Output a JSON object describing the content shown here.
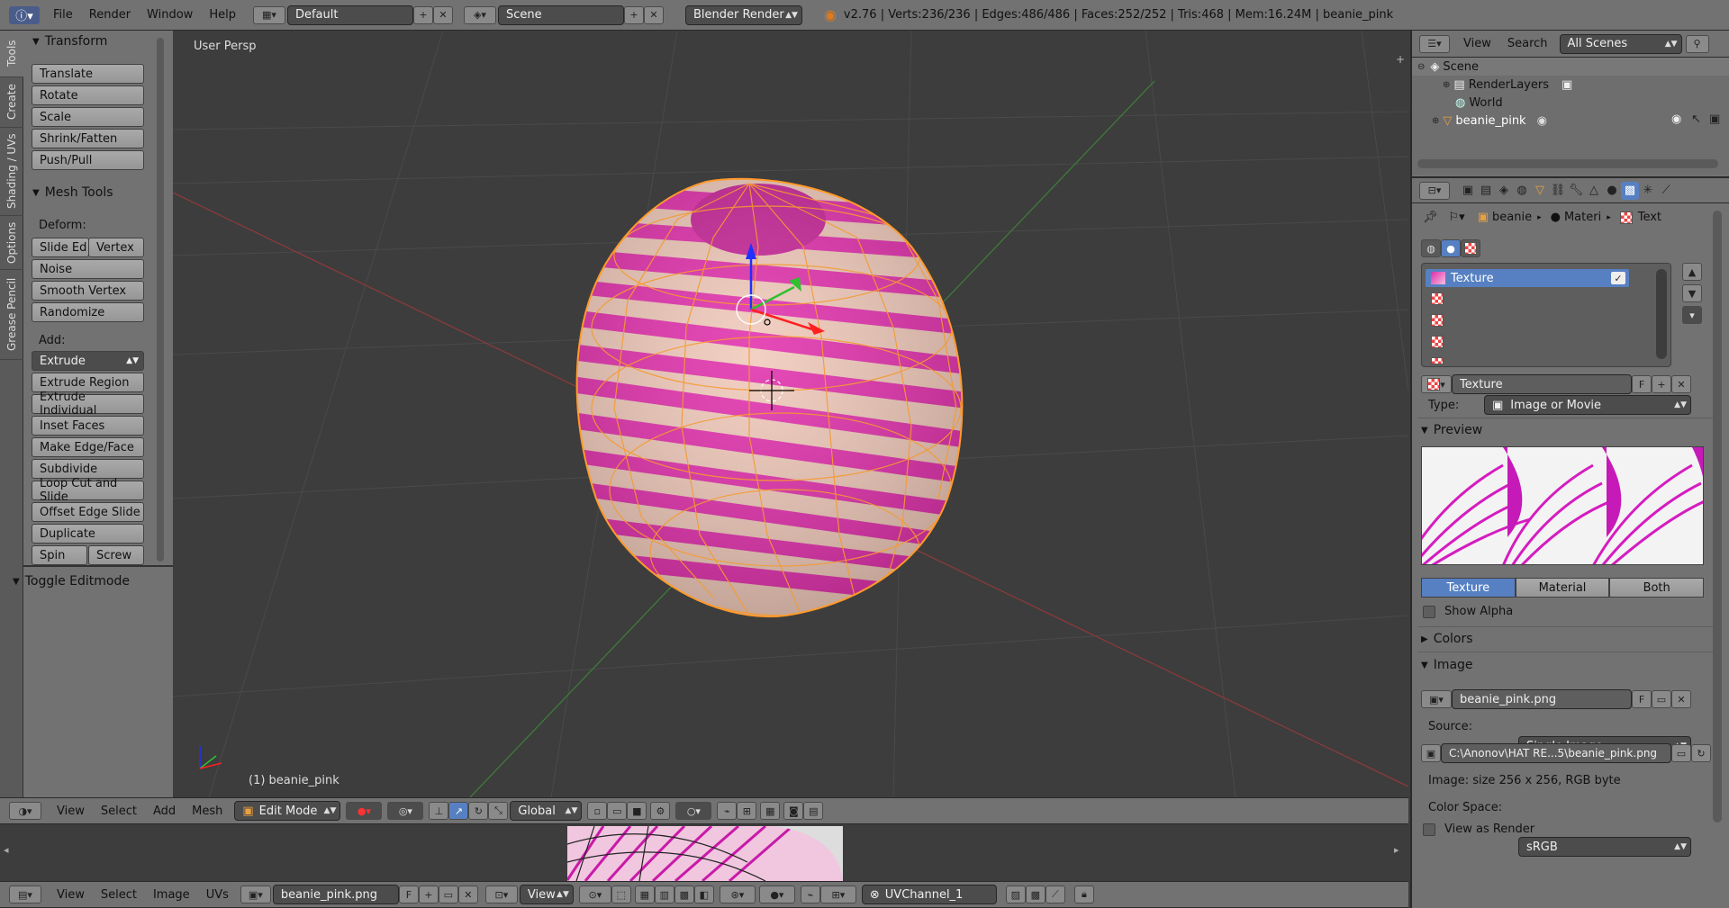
{
  "topbar": {
    "menus": [
      "File",
      "Render",
      "Window",
      "Help"
    ],
    "layout": "Default",
    "scene": "Scene",
    "engine": "Blender Render",
    "stats": "v2.76 | Verts:236/236 | Edges:486/486 | Faces:252/252 | Tris:468 | Mem:16.24M | beanie_pink"
  },
  "toolshelf": {
    "tabs": [
      "Tools",
      "Create",
      "Shading / UVs",
      "Options",
      "Grease Pencil"
    ],
    "transform": {
      "title": "Transform",
      "buttons": [
        "Translate",
        "Rotate",
        "Scale",
        "Shrink/Fatten",
        "Push/Pull"
      ]
    },
    "mesh_tools": {
      "title": "Mesh Tools",
      "deform_label": "Deform:",
      "slide_edge": "Slide Ed",
      "vertex": "Vertex",
      "noise": "Noise",
      "smooth_vertex": "Smooth Vertex",
      "randomize": "Randomize",
      "add_label": "Add:",
      "extrude": "Extrude",
      "add_buttons": [
        "Extrude Region",
        "Extrude Individual",
        "Inset Faces",
        "Make Edge/Face",
        "Subdivide",
        "Loop Cut and Slide",
        "Offset Edge Slide",
        "Duplicate"
      ],
      "spin": "Spin",
      "screw": "Screw"
    },
    "toggle_editmode": "Toggle Editmode"
  },
  "viewport": {
    "view_label": "User Persp",
    "object_label": "(1) beanie_pink"
  },
  "viewport_header": {
    "menus": [
      "View",
      "Select",
      "Add",
      "Mesh"
    ],
    "mode": "Edit Mode",
    "orientation": "Global"
  },
  "uv_header": {
    "menus": [
      "View",
      "Select",
      "Image",
      "UVs"
    ],
    "image": "beanie_pink.png",
    "f": "F",
    "view": "View",
    "uv_channel": "UVChannel_1"
  },
  "outliner": {
    "menus": [
      "View",
      "Search"
    ],
    "scenes": "All Scenes",
    "items": [
      {
        "name": "Scene",
        "indent": 0
      },
      {
        "name": "RenderLayers",
        "indent": 1
      },
      {
        "name": "World",
        "indent": 1
      },
      {
        "name": "beanie_pink",
        "indent": 1
      }
    ]
  },
  "properties": {
    "breadcrumb": [
      "beanie",
      "Materi",
      "Text"
    ],
    "texture_slot": "Texture",
    "texture_name": "Texture",
    "f": "F",
    "type_label": "Type:",
    "type_value": "Image or Movie",
    "preview_title": "Preview",
    "preview_tabs": [
      "Texture",
      "Material",
      "Both"
    ],
    "show_alpha": "Show Alpha",
    "colors_title": "Colors",
    "image_title": "Image",
    "image_name": "beanie_pink.png",
    "source_label": "Source:",
    "source_value": "Single Image",
    "filepath": "C:\\Anonov\\HAT RE...5\\beanie_pink.png",
    "image_size": "Image: size 256 x 256, RGB byte",
    "colorspace_label": "Color Space:",
    "colorspace_value": "sRGB",
    "view_as_render": "View as Render"
  }
}
